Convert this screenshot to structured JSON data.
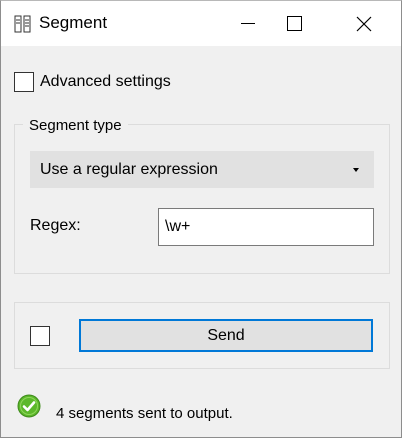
{
  "window": {
    "title": "Segment",
    "icon": "segment-app-icon"
  },
  "advanced": {
    "label": "Advanced settings",
    "checked": false
  },
  "segment_type": {
    "group_title": "Segment type",
    "selected": "Use a regular expression"
  },
  "regex": {
    "label": "Regex:",
    "value": "\\w+"
  },
  "send": {
    "auto_checked": false,
    "label": "Send"
  },
  "status": {
    "icon": "check-circle-icon",
    "text": "4 segments sent to output."
  },
  "colors": {
    "background": "#f0f0f0",
    "titlebar": "#ffffff",
    "button_border": "#0078d7",
    "status_green": "#5cb82b"
  }
}
